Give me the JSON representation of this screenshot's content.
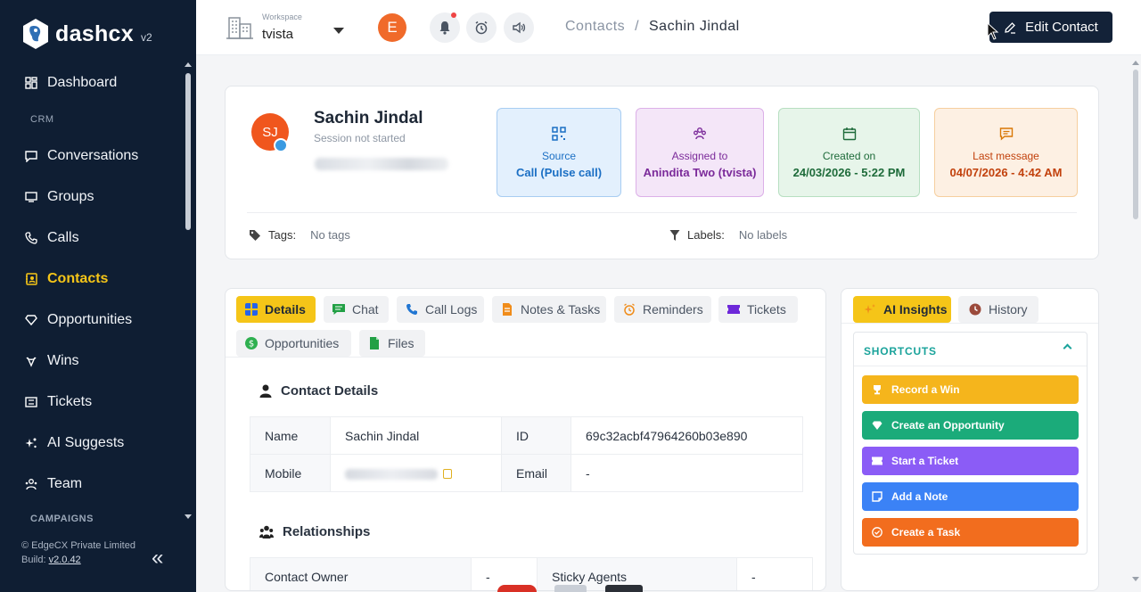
{
  "brand": {
    "name": "dashcx",
    "version": "v2"
  },
  "sidebar": {
    "items": [
      {
        "label": "Dashboard",
        "icon": "dashboard-icon"
      },
      {
        "section": "CRM"
      },
      {
        "label": "Conversations",
        "icon": "chat-icon"
      },
      {
        "label": "Groups",
        "icon": "groups-icon"
      },
      {
        "label": "Calls",
        "icon": "phone-icon"
      },
      {
        "label": "Contacts",
        "icon": "contacts-icon",
        "active": true
      },
      {
        "label": "Opportunities",
        "icon": "diamond-icon"
      },
      {
        "label": "Wins",
        "icon": "trophy-icon"
      },
      {
        "label": "Tickets",
        "icon": "ticket-icon"
      },
      {
        "label": "AI Suggests",
        "icon": "sparkle-icon"
      },
      {
        "label": "Team",
        "icon": "team-icon"
      },
      {
        "section": "CAMPAIGNS"
      }
    ],
    "footer": {
      "copyright": "© EdgeCX Private Limited",
      "build_label": "Build:",
      "build": "v2.0.42"
    },
    "collapse_icon": "double-chevron-left-icon"
  },
  "topbar": {
    "workspace_label": "Workspace",
    "workspace_name": "tvista",
    "user_initial": "E",
    "breadcrumb_parent": "Contacts",
    "breadcrumb_separator": "/",
    "breadcrumb_current": "Sachin Jindal",
    "edit_button": "Edit Contact"
  },
  "contact": {
    "initials": "SJ",
    "name": "Sachin Jindal",
    "session": "Session not started",
    "stats": [
      {
        "label": "Source",
        "value": "Call (Pulse call)",
        "icon": "qr-icon",
        "color": "#1b6fc4",
        "bg": "#e3f0fd",
        "border": "#a8cdf2"
      },
      {
        "label": "Assigned to",
        "value": "Anindita Two (tvista)",
        "icon": "people-icon",
        "color": "#7b2a9a",
        "bg": "#f4e6f8",
        "border": "#dcb0e8"
      },
      {
        "label": "Created on",
        "value": "24/03/2026 - 5:22 PM",
        "icon": "calendar-icon",
        "color": "#1e6b3a",
        "bg": "#e7f5ea",
        "border": "#b7dfc1"
      },
      {
        "label": "Last message",
        "value": "04/07/2026 - 4:42 AM",
        "icon": "message-icon",
        "color": "#c2410c",
        "bg": "#fdf0e3",
        "border": "#f6cf9f"
      }
    ],
    "tags_label": "Tags:",
    "tags_value": "No tags",
    "labels_label": "Labels:",
    "labels_value": "No labels"
  },
  "tabs": [
    {
      "label": "Details",
      "active": true,
      "icon": "grid-icon"
    },
    {
      "label": "Chat",
      "icon": "chat-icon"
    },
    {
      "label": "Call Logs",
      "icon": "phone-icon"
    },
    {
      "label": "Notes & Tasks",
      "icon": "note-icon"
    },
    {
      "label": "Reminders",
      "icon": "alarm-icon"
    },
    {
      "label": "Tickets",
      "icon": "ticket-icon"
    },
    {
      "label": "Opportunities",
      "icon": "dollar-icon"
    },
    {
      "label": "Files",
      "icon": "file-icon"
    }
  ],
  "details": {
    "title": "Contact Details",
    "rows": [
      {
        "k1": "Name",
        "v1": "Sachin Jindal",
        "k2": "ID",
        "v2": "69c32acbf47964260b03e890"
      },
      {
        "k1": "Mobile",
        "v1": "",
        "k2": "Email",
        "v2": "-"
      }
    ],
    "relationships_title": "Relationships",
    "rel_row": {
      "k1": "Contact Owner",
      "v1": "-",
      "k2": "Sticky Agents",
      "v2": "-"
    }
  },
  "ai_panel": {
    "tab_ai": "AI Insights",
    "tab_history": "History",
    "shortcuts_title": "SHORTCUTS",
    "buttons": [
      {
        "label": "Record a Win",
        "icon": "trophy-icon",
        "color": "#f5b51c"
      },
      {
        "label": "Create an Opportunity",
        "icon": "diamond-icon",
        "color": "#1bab7a"
      },
      {
        "label": "Start a Ticket",
        "icon": "ticket-icon",
        "color": "#8b5cf6"
      },
      {
        "label": "Add a Note",
        "icon": "note-icon",
        "color": "#3b82f6"
      },
      {
        "label": "Create a Task",
        "icon": "check-circle-icon",
        "color": "#f26d1e"
      }
    ]
  }
}
